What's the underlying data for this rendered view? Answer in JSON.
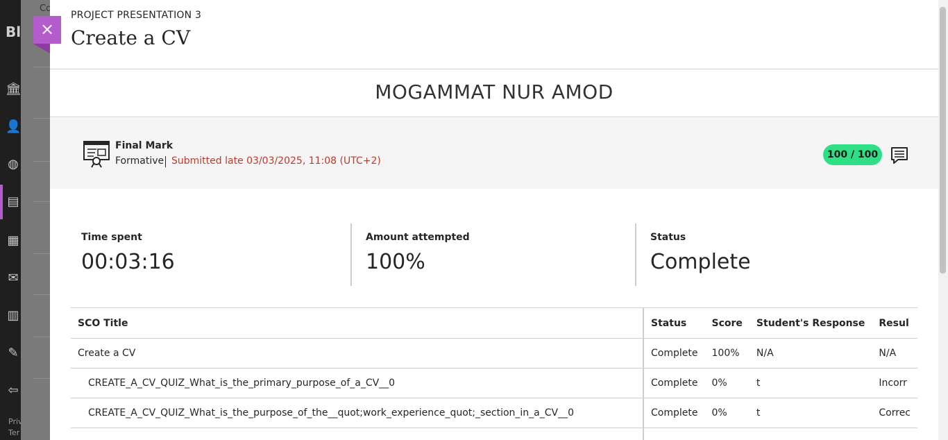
{
  "background": {
    "tab_fragment": "Co",
    "logo_fragment": "Bl",
    "footer_line1": "Priv",
    "footer_line2": "Ter"
  },
  "header": {
    "eyebrow": "PROJECT PRESENTATION 3",
    "title": "Create a CV",
    "close_label": "×"
  },
  "student_name": "MOGAMMAT NUR AMOD",
  "grade": {
    "item_label": "Final Mark",
    "category": "Formative",
    "submission_status": "Submitted late 03/03/2025, 11:08 (UTC+2)",
    "score": "100 / 100",
    "feedback_icon": "feedback-comment-icon"
  },
  "stats": [
    {
      "label": "Time spent",
      "value": "00:03:16"
    },
    {
      "label": "Amount attempted",
      "value": "100%"
    },
    {
      "label": "Status",
      "value": "Complete"
    }
  ],
  "table": {
    "headers": [
      "SCO Title",
      "Status",
      "Score",
      "Student's Response",
      "Resul"
    ],
    "rows": [
      [
        "Create a CV",
        "Complete",
        "100%",
        "N/A",
        "N/A"
      ],
      [
        "CREATE_A_CV_QUIZ_What_is_the_primary_purpose_of_a_CV__0",
        "Complete",
        "0%",
        "t",
        "Incorr"
      ],
      [
        "CREATE_A_CV_QUIZ_What_is_the_purpose_of_the__quot;work_experience_quot;_section_in_a_CV__0",
        "Complete",
        "0%",
        "t",
        "Correc"
      ]
    ]
  },
  "colors": {
    "accent": "#b45ccc",
    "score_pill": "#2fdf85",
    "late_text": "#c0392b"
  }
}
